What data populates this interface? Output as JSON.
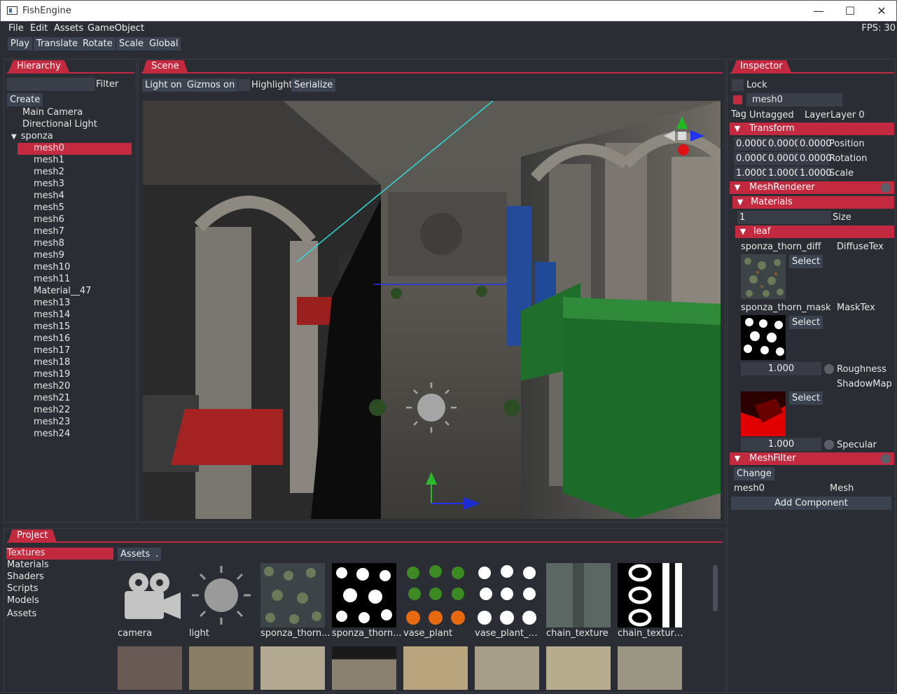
{
  "window": {
    "title": "FishEngine"
  },
  "menu": {
    "items": [
      "File",
      "Edit",
      "Assets",
      "GameObject"
    ],
    "fps": "FPS: 30"
  },
  "toolbar": {
    "play": "Play",
    "translate": "Translate",
    "rotate": "Rotate",
    "scale": "Scale",
    "global": "Global"
  },
  "hierarchy": {
    "tab": "Hierarchy",
    "filter": "Filter",
    "create": "Create",
    "top_items": [
      "Main Camera",
      "Directional Light",
      "sponza"
    ],
    "children": [
      "mesh0",
      "mesh1",
      "mesh2",
      "mesh3",
      "mesh4",
      "mesh5",
      "mesh6",
      "mesh7",
      "mesh8",
      "mesh9",
      "mesh10",
      "mesh11",
      "Material__47",
      "mesh13",
      "mesh14",
      "mesh15",
      "mesh16",
      "mesh17",
      "mesh18",
      "mesh19",
      "mesh20",
      "mesh21",
      "mesh22",
      "mesh23",
      "mesh24"
    ],
    "selected": "mesh0"
  },
  "scene": {
    "tab": "Scene",
    "light": "Light on",
    "gizmos": "Gizmos on",
    "highlight": "Highlight",
    "serialize": "Serialize"
  },
  "inspector": {
    "tab": "Inspector",
    "lock": "Lock",
    "name": "mesh0",
    "tag_label": "Tag",
    "tag_value": "Untagged",
    "layer_label": "Layer",
    "layer_value": "Layer 0",
    "transform": {
      "header": "Transform",
      "position": [
        "0.0000",
        "0.0000",
        "0.0000"
      ],
      "position_label": "Position",
      "rotation": [
        "0.0000",
        "0.0000",
        "0.0000"
      ],
      "rotation_label": "Rotation",
      "scale": [
        "1.0000",
        "1.0000",
        "1.0000"
      ],
      "scale_label": "Scale"
    },
    "mesh_renderer": {
      "header": "MeshRenderer",
      "materials_header": "Materials",
      "size_value": "1",
      "size_label": "Size",
      "material_header": "leaf",
      "diffuse_name": "sponza_thorn_diff",
      "diffuse_label": "DiffuseTex",
      "mask_name": "sponza_thorn_mask",
      "mask_label": "MaskTex",
      "select": "Select",
      "roughness_value": "1.000",
      "roughness_label": "Roughness",
      "shadow_label": "ShadowMap",
      "specular_value": "1.000",
      "specular_label": "Specular"
    },
    "mesh_filter": {
      "header": "MeshFilter",
      "change": "Change",
      "mesh_value": "mesh0",
      "mesh_label": "Mesh"
    },
    "add_component": "Add Component"
  },
  "project": {
    "tab": "Project",
    "folders": [
      "Textures",
      "Materials",
      "Shaders",
      "Scripts",
      "Models",
      "Assets"
    ],
    "selected_folder": "Textures",
    "breadcrumb": [
      "Assets",
      "."
    ],
    "assets_row1": [
      "camera",
      "light",
      "sponza_thorn...",
      "sponza_thorn...",
      "vase_plant",
      "vase_plant_m...",
      "chain_texture",
      "chain_texture..."
    ]
  },
  "colors": {
    "accent": "#c3293f",
    "panel": "#2b2d34",
    "button": "#3c4350"
  }
}
